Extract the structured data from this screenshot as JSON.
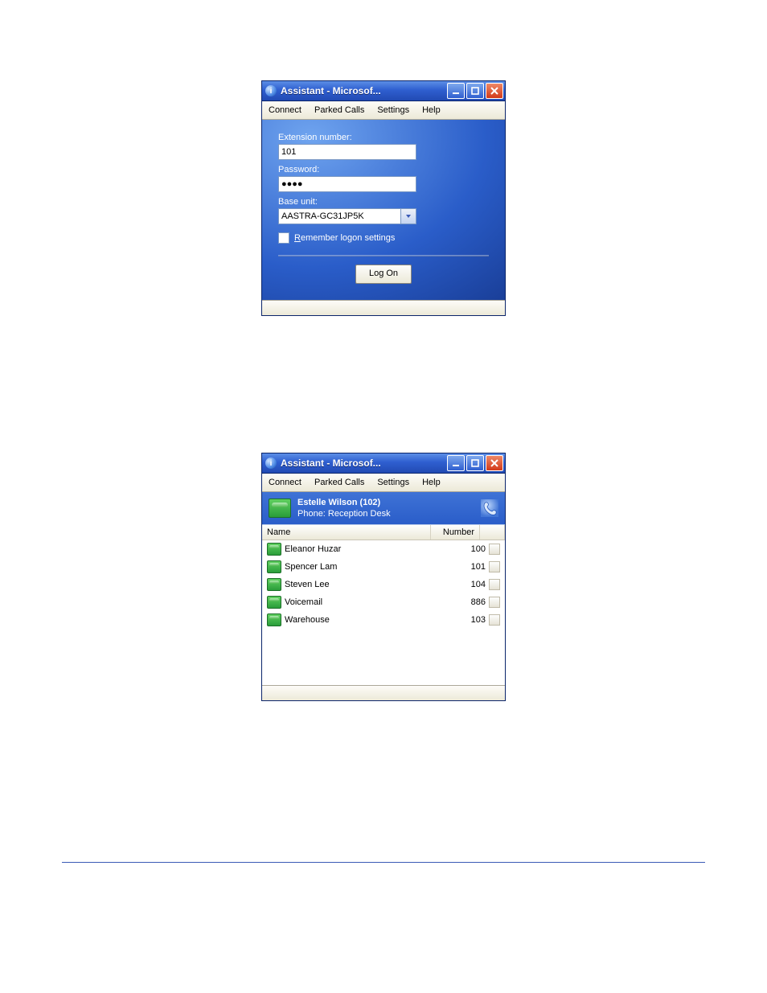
{
  "win1": {
    "title": "Assistant - Microsof...",
    "menu": [
      "Connect",
      "Parked Calls",
      "Settings",
      "Help"
    ],
    "ext_label": "Extension number:",
    "ext_value": "101",
    "pwd_label": "Password:",
    "pwd_value": "●●●●",
    "base_label": "Base unit:",
    "base_value": "AASTRA-GC31JP5K",
    "remember_prefix": "R",
    "remember_rest": "emember logon settings",
    "logon": "Log On"
  },
  "win2": {
    "title": "Assistant - Microsof...",
    "menu": [
      "Connect",
      "Parked Calls",
      "Settings",
      "Help"
    ],
    "user_name": "Estelle Wilson (102)",
    "user_phone": "Phone:  Reception Desk",
    "col_name": "Name",
    "col_number": "Number",
    "rows": [
      {
        "name": "Eleanor Huzar",
        "number": "100"
      },
      {
        "name": "Spencer Lam",
        "number": "101"
      },
      {
        "name": "Steven Lee",
        "number": "104"
      },
      {
        "name": "Voicemail",
        "number": "886"
      },
      {
        "name": "Warehouse",
        "number": "103"
      }
    ]
  }
}
